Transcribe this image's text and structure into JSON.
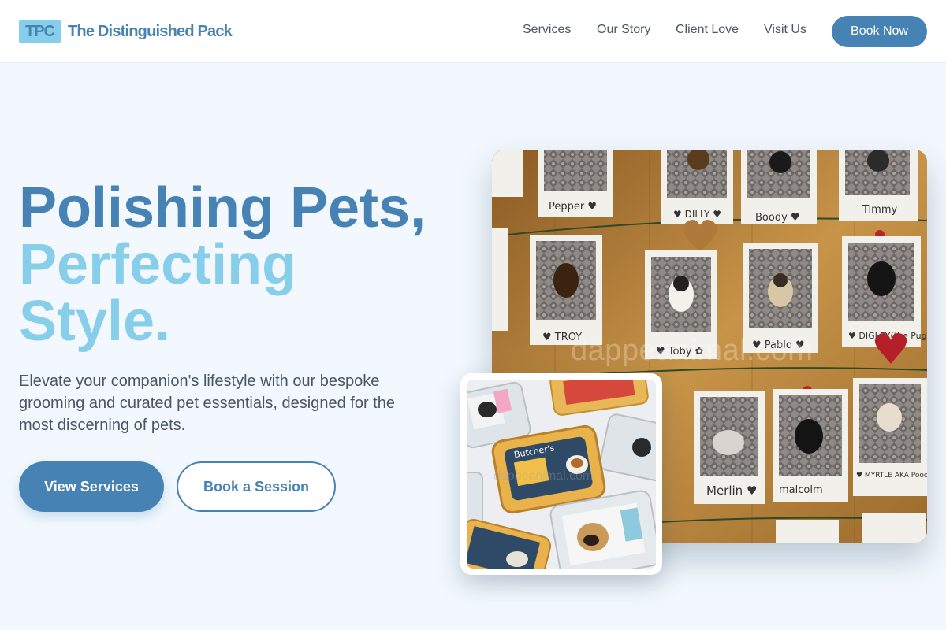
{
  "brand": {
    "abbr": "TPC",
    "name": "The Distinguished Pack"
  },
  "nav": {
    "items": [
      {
        "label": "Services"
      },
      {
        "label": "Our Story"
      },
      {
        "label": "Client Love"
      },
      {
        "label": "Visit Us"
      }
    ],
    "cta_label": "Book Now"
  },
  "hero": {
    "headline_line1": "Polishing Pets,",
    "headline_line2": "Perfecting",
    "headline_line3": "Style.",
    "subtext": "Elevate your companion's lifestyle with our bespoke grooming and curated pet essentials, designed for the most discerning of pets.",
    "primary_button": "View Services",
    "secondary_button": "Book a Session"
  },
  "images": {
    "main_watermark": "dappeanimal.com",
    "small_watermark": "dappeanimal.com",
    "polaroid_names": [
      "Pepper",
      "DILLY",
      "Boody",
      "Timmy",
      "TROY",
      "Toby",
      "Pablo",
      "DIGLEY (the Pug)",
      "Merlin",
      "Malcolm",
      "MYRTLE AKA Pooch Face!"
    ],
    "tray_brand": "Butcher's"
  },
  "colors": {
    "primary": "#4682b4",
    "accent": "#87ceeb",
    "text": "#4b5563",
    "background": "#f2f8fd"
  }
}
